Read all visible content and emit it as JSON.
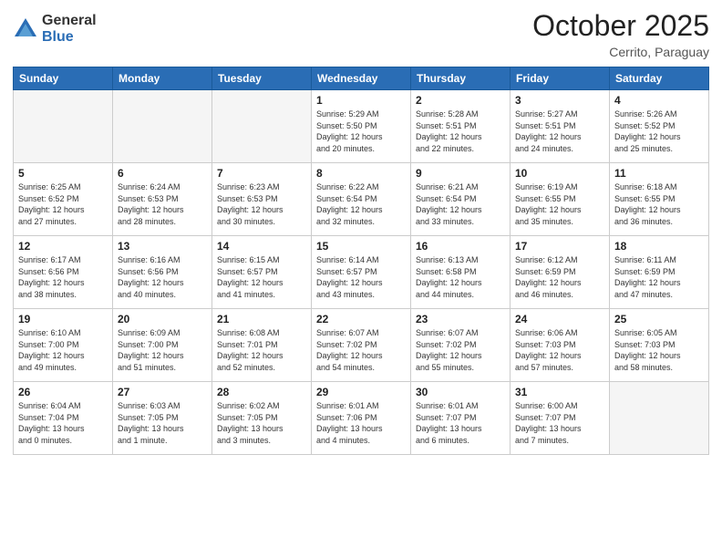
{
  "header": {
    "logo_general": "General",
    "logo_blue": "Blue",
    "month_title": "October 2025",
    "subtitle": "Cerrito, Paraguay"
  },
  "days_of_week": [
    "Sunday",
    "Monday",
    "Tuesday",
    "Wednesday",
    "Thursday",
    "Friday",
    "Saturday"
  ],
  "weeks": [
    [
      {
        "day": "",
        "info": ""
      },
      {
        "day": "",
        "info": ""
      },
      {
        "day": "",
        "info": ""
      },
      {
        "day": "1",
        "info": "Sunrise: 5:29 AM\nSunset: 5:50 PM\nDaylight: 12 hours\nand 20 minutes."
      },
      {
        "day": "2",
        "info": "Sunrise: 5:28 AM\nSunset: 5:51 PM\nDaylight: 12 hours\nand 22 minutes."
      },
      {
        "day": "3",
        "info": "Sunrise: 5:27 AM\nSunset: 5:51 PM\nDaylight: 12 hours\nand 24 minutes."
      },
      {
        "day": "4",
        "info": "Sunrise: 5:26 AM\nSunset: 5:52 PM\nDaylight: 12 hours\nand 25 minutes."
      }
    ],
    [
      {
        "day": "5",
        "info": "Sunrise: 6:25 AM\nSunset: 6:52 PM\nDaylight: 12 hours\nand 27 minutes."
      },
      {
        "day": "6",
        "info": "Sunrise: 6:24 AM\nSunset: 6:53 PM\nDaylight: 12 hours\nand 28 minutes."
      },
      {
        "day": "7",
        "info": "Sunrise: 6:23 AM\nSunset: 6:53 PM\nDaylight: 12 hours\nand 30 minutes."
      },
      {
        "day": "8",
        "info": "Sunrise: 6:22 AM\nSunset: 6:54 PM\nDaylight: 12 hours\nand 32 minutes."
      },
      {
        "day": "9",
        "info": "Sunrise: 6:21 AM\nSunset: 6:54 PM\nDaylight: 12 hours\nand 33 minutes."
      },
      {
        "day": "10",
        "info": "Sunrise: 6:19 AM\nSunset: 6:55 PM\nDaylight: 12 hours\nand 35 minutes."
      },
      {
        "day": "11",
        "info": "Sunrise: 6:18 AM\nSunset: 6:55 PM\nDaylight: 12 hours\nand 36 minutes."
      }
    ],
    [
      {
        "day": "12",
        "info": "Sunrise: 6:17 AM\nSunset: 6:56 PM\nDaylight: 12 hours\nand 38 minutes."
      },
      {
        "day": "13",
        "info": "Sunrise: 6:16 AM\nSunset: 6:56 PM\nDaylight: 12 hours\nand 40 minutes."
      },
      {
        "day": "14",
        "info": "Sunrise: 6:15 AM\nSunset: 6:57 PM\nDaylight: 12 hours\nand 41 minutes."
      },
      {
        "day": "15",
        "info": "Sunrise: 6:14 AM\nSunset: 6:57 PM\nDaylight: 12 hours\nand 43 minutes."
      },
      {
        "day": "16",
        "info": "Sunrise: 6:13 AM\nSunset: 6:58 PM\nDaylight: 12 hours\nand 44 minutes."
      },
      {
        "day": "17",
        "info": "Sunrise: 6:12 AM\nSunset: 6:59 PM\nDaylight: 12 hours\nand 46 minutes."
      },
      {
        "day": "18",
        "info": "Sunrise: 6:11 AM\nSunset: 6:59 PM\nDaylight: 12 hours\nand 47 minutes."
      }
    ],
    [
      {
        "day": "19",
        "info": "Sunrise: 6:10 AM\nSunset: 7:00 PM\nDaylight: 12 hours\nand 49 minutes."
      },
      {
        "day": "20",
        "info": "Sunrise: 6:09 AM\nSunset: 7:00 PM\nDaylight: 12 hours\nand 51 minutes."
      },
      {
        "day": "21",
        "info": "Sunrise: 6:08 AM\nSunset: 7:01 PM\nDaylight: 12 hours\nand 52 minutes."
      },
      {
        "day": "22",
        "info": "Sunrise: 6:07 AM\nSunset: 7:02 PM\nDaylight: 12 hours\nand 54 minutes."
      },
      {
        "day": "23",
        "info": "Sunrise: 6:07 AM\nSunset: 7:02 PM\nDaylight: 12 hours\nand 55 minutes."
      },
      {
        "day": "24",
        "info": "Sunrise: 6:06 AM\nSunset: 7:03 PM\nDaylight: 12 hours\nand 57 minutes."
      },
      {
        "day": "25",
        "info": "Sunrise: 6:05 AM\nSunset: 7:03 PM\nDaylight: 12 hours\nand 58 minutes."
      }
    ],
    [
      {
        "day": "26",
        "info": "Sunrise: 6:04 AM\nSunset: 7:04 PM\nDaylight: 13 hours\nand 0 minutes."
      },
      {
        "day": "27",
        "info": "Sunrise: 6:03 AM\nSunset: 7:05 PM\nDaylight: 13 hours\nand 1 minute."
      },
      {
        "day": "28",
        "info": "Sunrise: 6:02 AM\nSunset: 7:05 PM\nDaylight: 13 hours\nand 3 minutes."
      },
      {
        "day": "29",
        "info": "Sunrise: 6:01 AM\nSunset: 7:06 PM\nDaylight: 13 hours\nand 4 minutes."
      },
      {
        "day": "30",
        "info": "Sunrise: 6:01 AM\nSunset: 7:07 PM\nDaylight: 13 hours\nand 6 minutes."
      },
      {
        "day": "31",
        "info": "Sunrise: 6:00 AM\nSunset: 7:07 PM\nDaylight: 13 hours\nand 7 minutes."
      },
      {
        "day": "",
        "info": ""
      }
    ]
  ]
}
